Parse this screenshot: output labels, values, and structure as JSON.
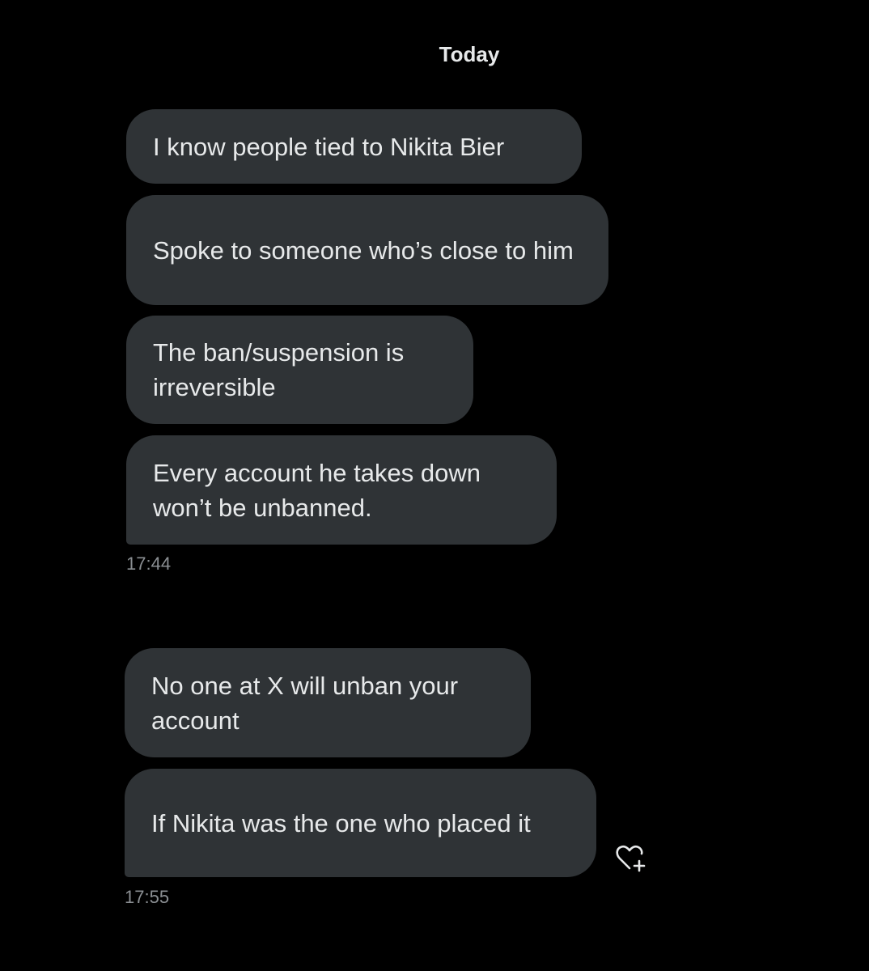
{
  "conversation": {
    "date_label": "Today",
    "groups": [
      {
        "messages": [
          {
            "text": "I know people tied to Nikita Bier"
          },
          {
            "text": "Spoke to someone who’s close to him"
          },
          {
            "text": "The ban/suspension is irreversible"
          },
          {
            "text": "Every account he takes down won’t be unbanned."
          }
        ],
        "time": "17:44"
      },
      {
        "messages": [
          {
            "text": "No one at X will unban your account"
          },
          {
            "text": "If Nikita was the one who placed it"
          }
        ],
        "time": "17:55"
      }
    ],
    "react_icon": "heart-plus-icon"
  },
  "colors": {
    "background": "#000000",
    "bubble": "#2f3336",
    "text": "#e7e9ea",
    "timestamp": "#8b8f93"
  }
}
